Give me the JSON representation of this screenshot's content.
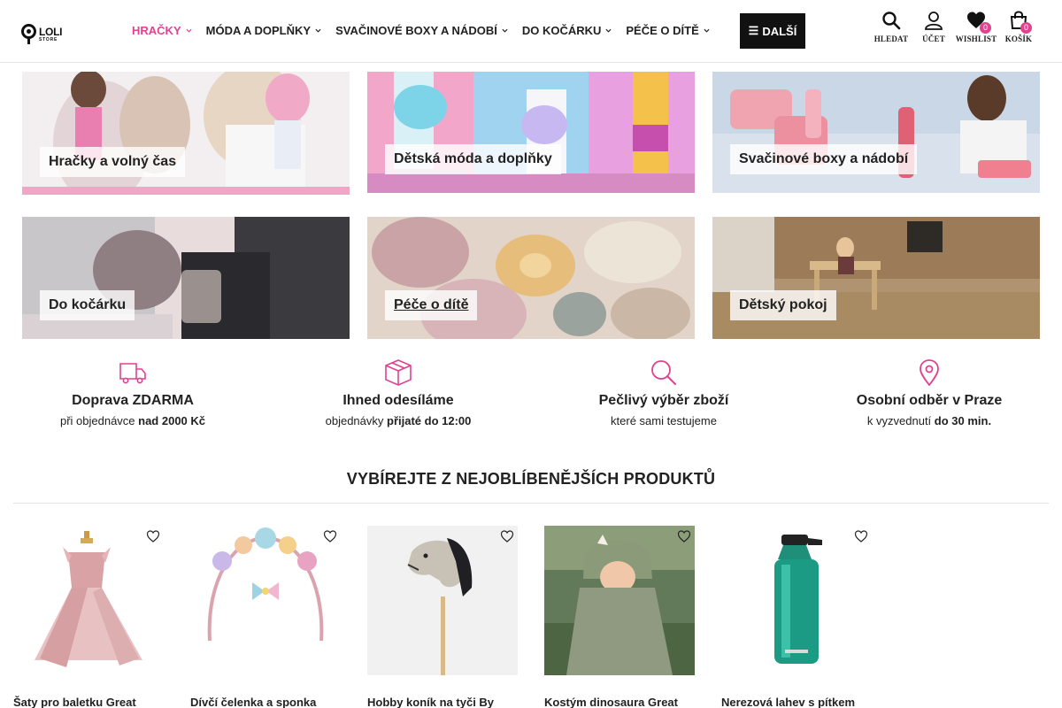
{
  "header": {
    "logo": {
      "line1": "LOLI",
      "line2": "STORE"
    },
    "nav": [
      {
        "label": "HRAČKY",
        "active": true
      },
      {
        "label": "MÓDA A DOPLŇKY",
        "active": false
      },
      {
        "label": "SVAČINOVÉ BOXY A NÁDOBÍ",
        "active": false
      },
      {
        "label": "DO KOČÁRKU",
        "active": false
      },
      {
        "label": "PÉČE O DÍTĚ",
        "active": false
      }
    ],
    "more_label": "DALŠÍ",
    "search_label": "HLEDAT",
    "account_label": "ÚČET",
    "wishlist_label": "WISHLIST",
    "wishlist_count": "0",
    "cart_label": "KOŠÍK",
    "cart_count": "0"
  },
  "categories": [
    {
      "label": "Hračky a volný čas"
    },
    {
      "label": "Dětská móda a doplňky"
    },
    {
      "label": "Svačinové boxy a nádobí"
    },
    {
      "label": "Do kočárku"
    },
    {
      "label": "Péče o dítě"
    },
    {
      "label": "Dětský pokoj"
    }
  ],
  "features": [
    {
      "icon": "truck-icon",
      "title": "Doprava ZDARMA",
      "text": "při objednávce ",
      "bold": "nad 2000 Kč"
    },
    {
      "icon": "box-icon",
      "title": "Ihned odesíláme",
      "text": "objednávky ",
      "bold": "přijaté do 12:00"
    },
    {
      "icon": "search-icon",
      "title": "Pečlivý výběr zboží",
      "text": "které sami testujeme",
      "bold": ""
    },
    {
      "icon": "map-pin-icon",
      "title": "Osobní odběr v Praze",
      "text": "k vyzvednutí ",
      "bold": "do 30 min."
    }
  ],
  "section_title": "VYBÍREJTE Z NEJOBLÍBENĚJŠÍCH PRODUKTŮ",
  "products": [
    {
      "name": "Šaty pro baletku Great"
    },
    {
      "name": "Dívčí čelenka a sponka"
    },
    {
      "name": "Hobby koník na tyči By"
    },
    {
      "name": "Kostým dinosaura Great"
    },
    {
      "name": "Nerezová lahev s pítkem"
    }
  ],
  "colors": {
    "accent": "#e0428f",
    "dark": "#111111"
  }
}
